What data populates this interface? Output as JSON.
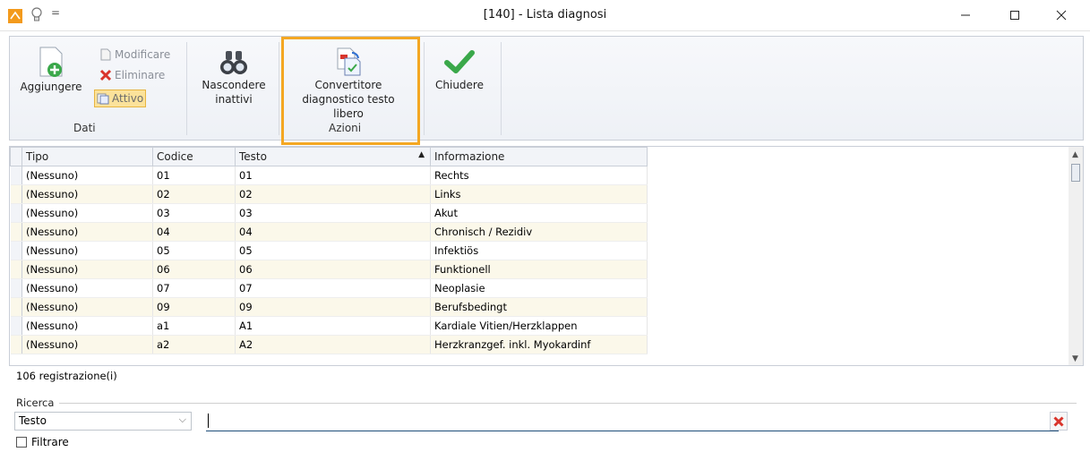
{
  "window": {
    "title": "[140] - Lista diagnosi",
    "quick_access": "=",
    "minimize": "—",
    "maximize": "☐",
    "close": "✕"
  },
  "ribbon": {
    "dati": {
      "group_label": "Dati",
      "add": "Aggiungere",
      "edit": "Modificare",
      "delete": "Eliminare",
      "active": "Attivo"
    },
    "hide_inactive": {
      "line1": "Nascondere",
      "line2": "inattivi"
    },
    "converter": {
      "line1": "Convertitore",
      "line2": "diagnostico testo libero"
    },
    "azioni_label": "Azioni",
    "close": "Chiudere"
  },
  "grid": {
    "columns": [
      "Tipo",
      "Codice",
      "Testo",
      "Informazione"
    ],
    "sort_indicator": "▲",
    "rows": [
      [
        "(Nessuno)",
        "01",
        "01",
        "Rechts"
      ],
      [
        "(Nessuno)",
        "02",
        "02",
        "Links"
      ],
      [
        "(Nessuno)",
        "03",
        "03",
        "Akut"
      ],
      [
        "(Nessuno)",
        "04",
        "04",
        "Chronisch / Rezidiv"
      ],
      [
        "(Nessuno)",
        "05",
        "05",
        "Infektiös"
      ],
      [
        "(Nessuno)",
        "06",
        "06",
        "Funktionell"
      ],
      [
        "(Nessuno)",
        "07",
        "07",
        "Neoplasie"
      ],
      [
        "(Nessuno)",
        "09",
        "09",
        "Berufsbedingt"
      ],
      [
        "(Nessuno)",
        "a1",
        "A1",
        "Kardiale Vitien/Herzklappen"
      ],
      [
        "(Nessuno)",
        "a2",
        "A2",
        "Herzkranzgef. inkl. Myokardinf"
      ]
    ]
  },
  "status": {
    "record_count": "106 registrazione(i)"
  },
  "search": {
    "legend": "Ricerca",
    "field_selected": "Testo",
    "value": ""
  },
  "filter": {
    "label": "Filtrare",
    "checked": false
  },
  "colors": {
    "highlight": "#f4a722",
    "accent_green": "#3aa84a",
    "delete_red": "#d9342b"
  }
}
